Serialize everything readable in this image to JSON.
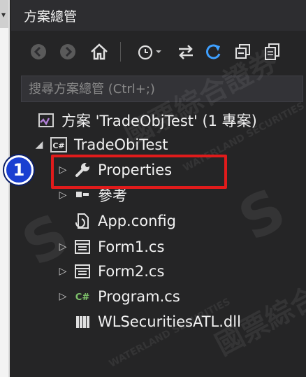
{
  "panel": {
    "title": "方案總管"
  },
  "toolbar": {
    "buttons": [
      {
        "name": "back-button",
        "icon": "arrow-left-icon"
      },
      {
        "name": "forward-button",
        "icon": "arrow-right-icon"
      },
      {
        "name": "home-button",
        "icon": "home-icon"
      },
      {
        "name": "history-button",
        "icon": "clock-icon"
      },
      {
        "name": "sync-button",
        "icon": "sync-arrows-icon"
      },
      {
        "name": "refresh-button",
        "icon": "refresh-icon"
      },
      {
        "name": "collapse-all-button",
        "icon": "collapse-all-icon"
      },
      {
        "name": "copy-button",
        "icon": "copy-icon"
      }
    ]
  },
  "search": {
    "placeholder": "搜尋方案總管 (Ctrl+;)"
  },
  "tree": {
    "solution": "方案 'TradeObjTest' (1 專案)",
    "project": "TradeObiTest",
    "items": [
      {
        "label": "Properties",
        "icon": "wrench-icon",
        "expandable": true,
        "highlighted": true
      },
      {
        "label": "參考",
        "icon": "references-icon",
        "expandable": true
      },
      {
        "label": "App.config",
        "icon": "config-file-icon",
        "expandable": false
      },
      {
        "label": "Form1.cs",
        "icon": "form-icon",
        "expandable": true
      },
      {
        "label": "Form2.cs",
        "icon": "form-icon",
        "expandable": true
      },
      {
        "label": "Program.cs",
        "icon": "csharp-file-icon",
        "expandable": true
      },
      {
        "label": "WLSecuritiesATL.dll",
        "icon": "dll-icon",
        "expandable": false
      }
    ]
  },
  "annotation": {
    "step": "1",
    "color": "#e01b1b",
    "badge_color": "#1a3fd1"
  },
  "watermark": {
    "text1": "國票綜合證券",
    "text2": "WATERLAND SECURITIES"
  }
}
